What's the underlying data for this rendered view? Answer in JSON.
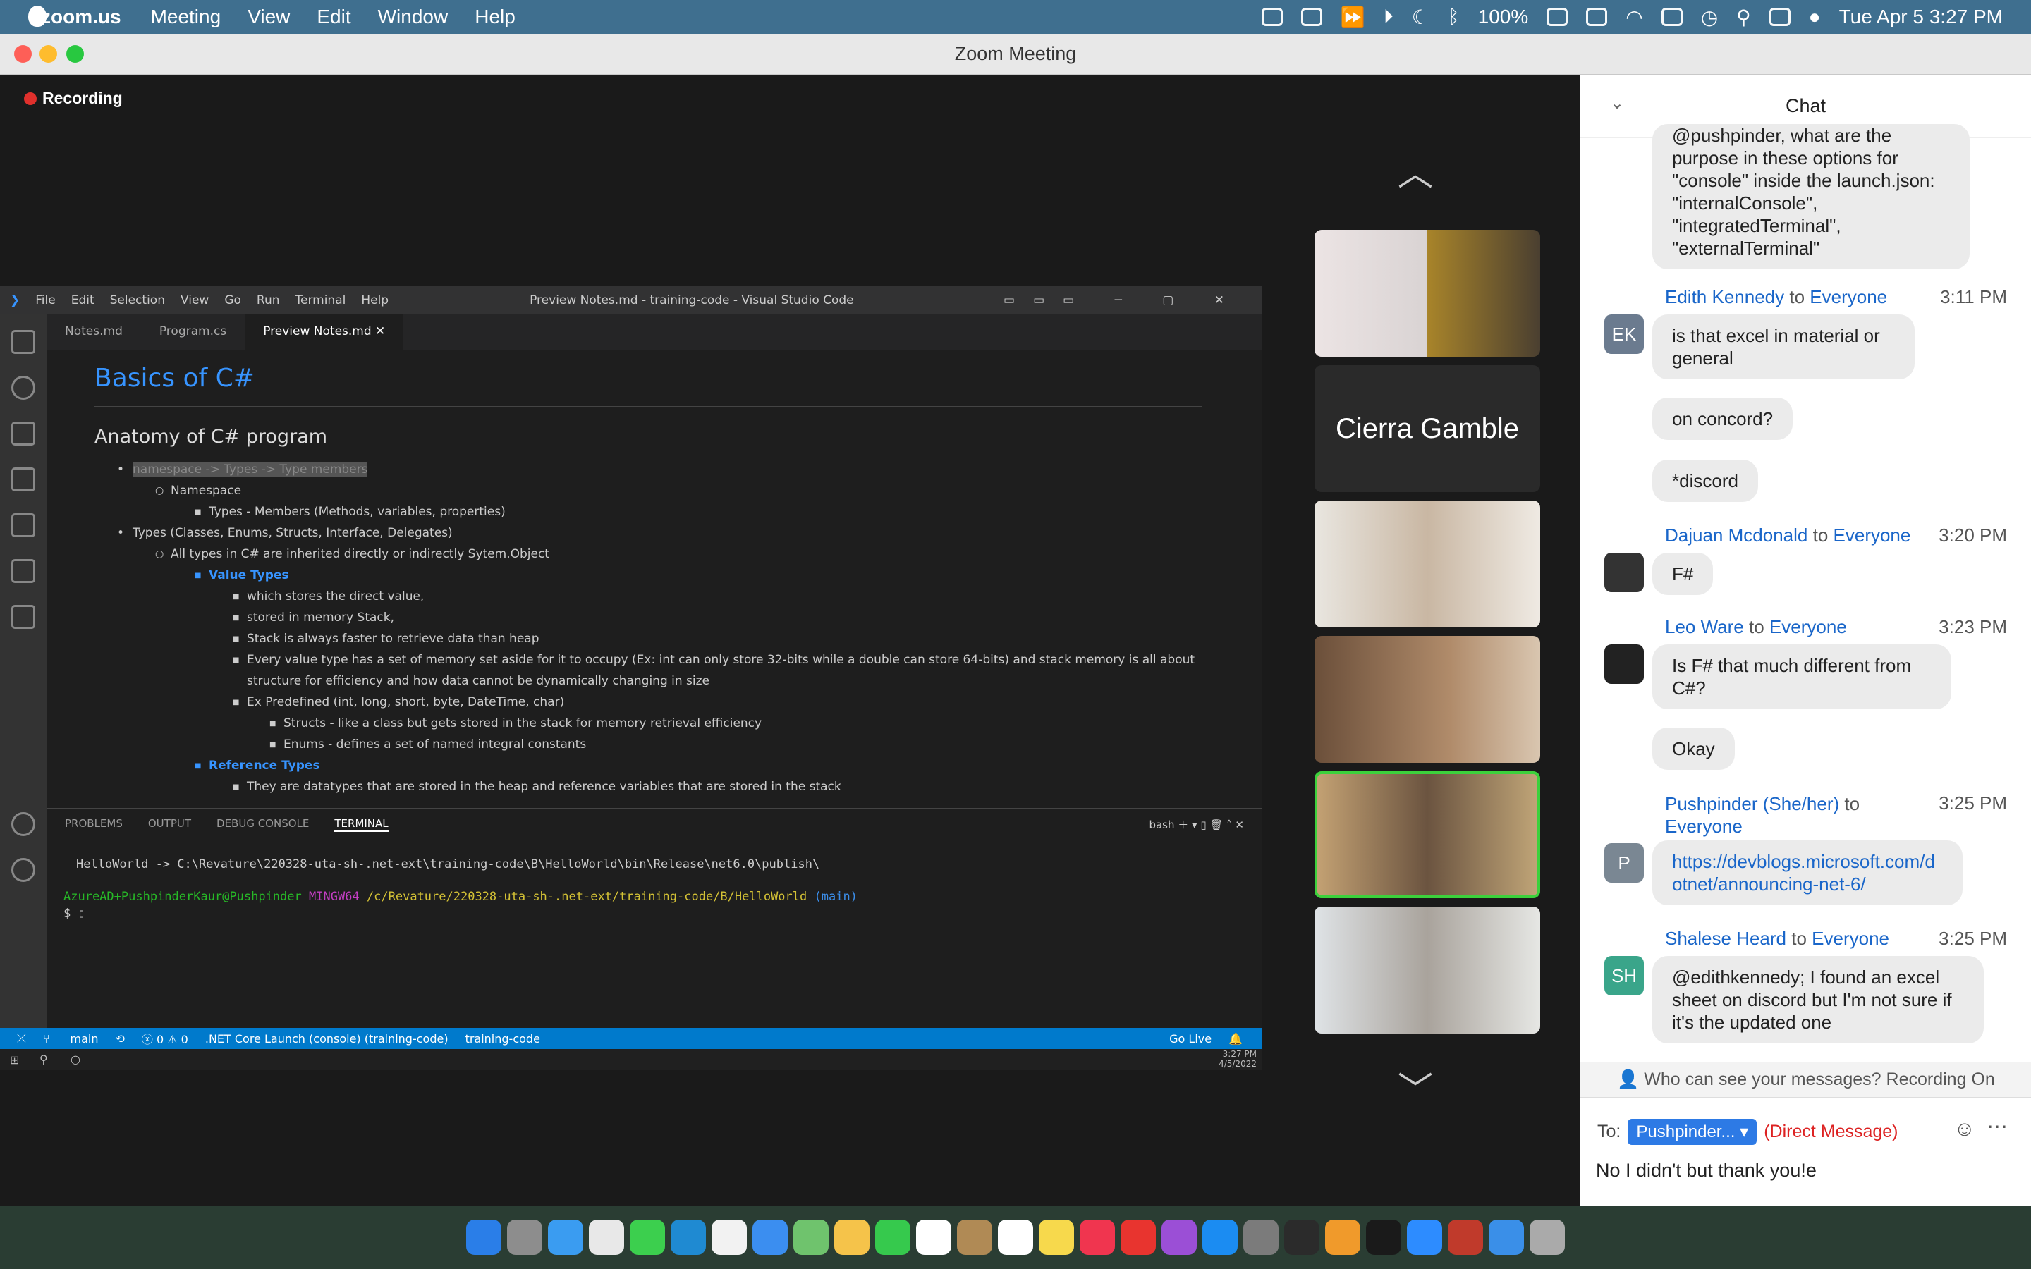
{
  "menubar": {
    "app": "zoom.us",
    "items": [
      "Meeting",
      "View",
      "Edit",
      "Window",
      "Help"
    ],
    "battery": "100%",
    "datetime": "Tue Apr 5  3:27 PM"
  },
  "window": {
    "title": "Zoom Meeting"
  },
  "meeting": {
    "recording": "Recording"
  },
  "vscode": {
    "menu": [
      "File",
      "Edit",
      "Selection",
      "View",
      "Go",
      "Run",
      "Terminal",
      "Help"
    ],
    "title": "Preview Notes.md - training-code - Visual Studio Code",
    "tabs": [
      "Notes.md",
      "Program.cs",
      "Preview Notes.md"
    ],
    "doc": {
      "title": "Basics of C#",
      "h2": "Anatomy of C# program",
      "lines": [
        "namespace -> Types -> Type members",
        "Namespace",
        "Types - Members (Methods, variables, properties)",
        "Types (Classes, Enums, Structs, Interface, Delegates)",
        "All types in C# are inherited directly or indirectly Sytem.Object",
        "Value Types",
        "which stores the direct value,",
        "stored in memory Stack,",
        "Stack is always faster to retrieve data than heap",
        "Every value type has a set of memory set aside for it to occupy (Ex: int can only store 32-bits while a double can store 64-bits) and stack memory is all about",
        "structure for efficiency and how data cannot be dynamically changing in size",
        "Ex Predefined (int, long, short, byte, DateTime, char)",
        "Structs - like a class but gets stored in the stack for memory retrieval efficiency",
        "Enums - defines a set of named integral constants",
        "Reference Types",
        "They are datatypes that are stored in the heap and reference variables that are stored in the stack"
      ]
    },
    "panel_tabs": [
      "PROBLEMS",
      "OUTPUT",
      "DEBUG CONSOLE",
      "TERMINAL"
    ],
    "shell": "bash",
    "terminal": [
      "HelloWorld -> C:\\Revature\\220328-uta-sh-.net-ext\\training-code\\B\\HelloWorld\\bin\\Release\\net6.0\\publish\\",
      "AzureAD+PushpinderKaur@Pushpinder",
      "MINGW64",
      "/c/Revature/220328-uta-sh-.net-ext/training-code/B/HelloWorld",
      "(main)",
      "$"
    ],
    "status": {
      "branch": "main",
      "errors": "ⓧ 0 ⚠ 0",
      "launch": ".NET Core Launch (console) (training-code)",
      "folder": "training-code",
      "golive": "Go Live"
    },
    "clock": {
      "time": "3:27 PM",
      "date": "4/5/2022"
    }
  },
  "gallery": {
    "name_tile": "Cierra Gamble"
  },
  "chat": {
    "header": "Chat",
    "messages": [
      {
        "text": "@pushpinder, what are the purpose in these options for \"console\" inside the launch.json:   \"internalConsole\", \"integratedTerminal\", \"externalTerminal\""
      },
      {
        "sender": "Edith Kennedy",
        "to": "to",
        "target": "Everyone",
        "time": "3:11 PM",
        "initials": "EK",
        "texts": [
          "is that excel in material or general",
          "on concord?",
          "*discord"
        ]
      },
      {
        "sender": "Dajuan Mcdonald",
        "to": "to",
        "target": "Everyone",
        "time": "3:20 PM",
        "texts": [
          "F#"
        ]
      },
      {
        "sender": "Leo Ware",
        "to": "to",
        "target": "Everyone",
        "time": "3:23 PM",
        "texts": [
          "Is F# that much different from C#?",
          "Okay"
        ]
      },
      {
        "sender": "Pushpinder (She/her)",
        "to": "to",
        "target": "Everyone",
        "time": "3:25 PM",
        "initials": "P",
        "texts": [
          "https://devblogs.microsoft.com/dotnet/announcing-net-6/"
        ]
      },
      {
        "sender": "Shalese Heard",
        "to": "to",
        "target": "Everyone",
        "time": "3:25 PM",
        "initials": "SH",
        "texts": [
          "@edithkennedy; I found an excel sheet on discord but I'm not sure if it's the updated one"
        ]
      }
    ],
    "visibility": "Who can see your messages? Recording On",
    "to_label": "To:",
    "recipient": "Pushpinder...",
    "dm_label": "(Direct Message)",
    "input": "No I didn't but thank you!e"
  },
  "colors": {
    "zoom_blue": "#2d7ae5",
    "vscode_blue": "#007acc",
    "link": "#1a66c9",
    "recording": "#e0302c"
  }
}
